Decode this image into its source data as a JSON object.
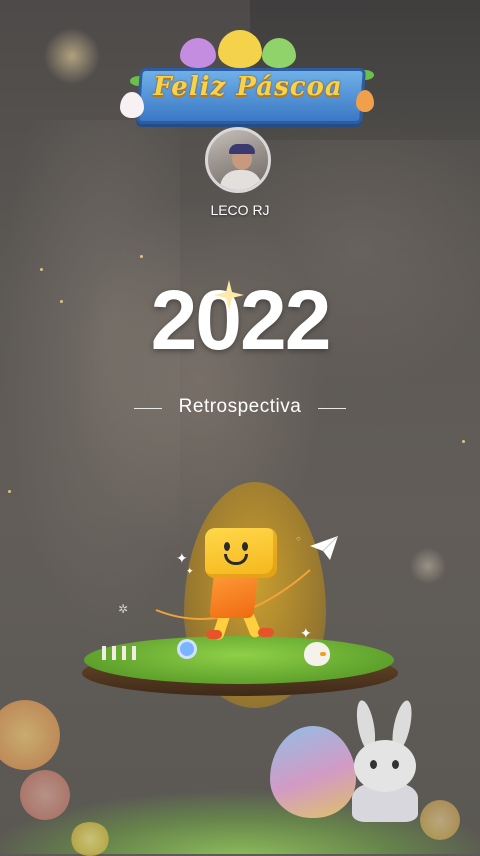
{
  "banner": {
    "title": "Feliz Páscoa"
  },
  "profile": {
    "username": "LECO RJ"
  },
  "retrospective": {
    "year": "2022",
    "label": "Retrospectiva"
  },
  "colors": {
    "banner_text": "#f6d34a",
    "banner_plate": "#3b78c4",
    "island_grass": "#5fa22c",
    "egg_glow": "#d9a628"
  },
  "icons": [
    "sparkle-icon",
    "paper-plane-icon",
    "mascot-character",
    "chick-icon",
    "bunny-icon"
  ]
}
